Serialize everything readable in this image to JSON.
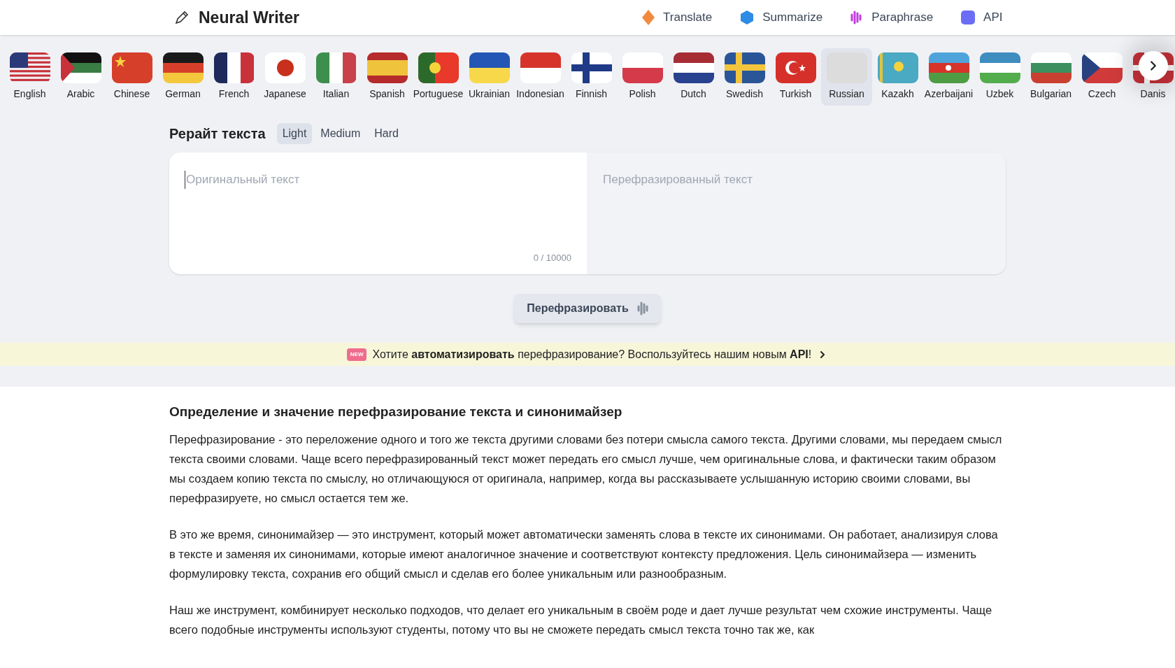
{
  "header": {
    "logo": "Neural Writer",
    "nav": [
      {
        "label": "Translate",
        "kind": "translate"
      },
      {
        "label": "Summarize",
        "kind": "summarize"
      },
      {
        "label": "Paraphrase",
        "kind": "paraphrase"
      },
      {
        "label": "API",
        "kind": "api"
      }
    ]
  },
  "languages": [
    {
      "label": "English",
      "selected": false
    },
    {
      "label": "Arabic",
      "selected": false
    },
    {
      "label": "Chinese",
      "selected": false
    },
    {
      "label": "German",
      "selected": false
    },
    {
      "label": "French",
      "selected": false
    },
    {
      "label": "Japanese",
      "selected": false
    },
    {
      "label": "Italian",
      "selected": false
    },
    {
      "label": "Spanish",
      "selected": false
    },
    {
      "label": "Portuguese",
      "selected": false
    },
    {
      "label": "Ukrainian",
      "selected": false
    },
    {
      "label": "Indonesian",
      "selected": false
    },
    {
      "label": "Finnish",
      "selected": false
    },
    {
      "label": "Polish",
      "selected": false
    },
    {
      "label": "Dutch",
      "selected": false
    },
    {
      "label": "Swedish",
      "selected": false
    },
    {
      "label": "Turkish",
      "selected": false
    },
    {
      "label": "Russian",
      "selected": true
    },
    {
      "label": "Kazakh",
      "selected": false
    },
    {
      "label": "Azerbaijani",
      "selected": false
    },
    {
      "label": "Uzbek",
      "selected": false
    },
    {
      "label": "Bulgarian",
      "selected": false
    },
    {
      "label": "Czech",
      "selected": false
    },
    {
      "label": "Danis",
      "selected": false
    }
  ],
  "editor": {
    "title": "Рерайт текста",
    "modes": [
      {
        "label": "Light",
        "selected": true
      },
      {
        "label": "Medium",
        "selected": false
      },
      {
        "label": "Hard",
        "selected": false
      }
    ],
    "input_placeholder": "Оригинальный текст",
    "counter": "0 / 10000",
    "output_placeholder": "Перефразированный текст",
    "button": "Перефразировать"
  },
  "banner": {
    "badge": "NEW",
    "text": "Хотите **автоматизировать** перефразирование? Воспользуйтесь нашим новым **API**!"
  },
  "article": {
    "heading": "Определение и значение перефразирование текста и синонимайзер",
    "paragraphs": [
      "Перефразирование - это переложение одного и того же текста другими словами без потери смысла самого текста. Другими словами, мы передаем смысл текста своими словами. Чаще всего перефразированный текст может передать его смысл лучше, чем оригинальные слова, и фактически таким образом мы создаем копию текста по смыслу, но отличающуюся от оригинала, например, когда вы рассказываете услышанную историю своими словами, вы перефразируете, но смысл остается тем же.",
      "В это же время, синонимайзер — это инструмент, который может автоматически заменять слова в тексте их синонимами. Он работает, анализируя слова в тексте и заменяя их синонимами, которые имеют аналогичное значение и соответствуют контексту предложения. Цель синонимайзера — изменить формулировку текста, сохранив его общий смысл и сделав его более уникальным или разнообразным.",
      "Наш же инструмент, комбинирует несколько подходов, что делает его уникальным в своём роде и дает лучше результат чем схожие инструменты. Чаще всего подобные инструменты используют студенты, потому что вы не сможете передать смысл текста точно так же, как"
    ]
  }
}
